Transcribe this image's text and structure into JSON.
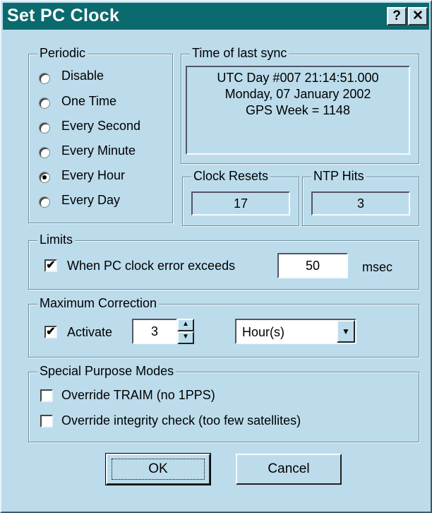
{
  "dialog": {
    "title": "Set PC Clock",
    "help_label": "?",
    "close_label": "✕"
  },
  "periodic": {
    "legend": "Periodic",
    "options": [
      {
        "label": "Disable",
        "selected": false
      },
      {
        "label": "One Time",
        "selected": false
      },
      {
        "label": "Every Second",
        "selected": false
      },
      {
        "label": "Every Minute",
        "selected": false
      },
      {
        "label": "Every Hour",
        "selected": true
      },
      {
        "label": "Every Day",
        "selected": false
      }
    ]
  },
  "last_sync": {
    "legend": "Time of last sync",
    "lines": [
      "UTC Day #007  21:14:51.000",
      "Monday, 07 January 2002",
      "GPS Week = 1148"
    ]
  },
  "clock_resets": {
    "legend": "Clock Resets",
    "value": "17"
  },
  "ntp_hits": {
    "legend": "NTP Hits",
    "value": "3"
  },
  "limits": {
    "legend": "Limits",
    "checkbox_label": "When PC clock error exceeds",
    "checked": true,
    "value": "50",
    "unit": "msec"
  },
  "max_correction": {
    "legend": "Maximum Correction",
    "checkbox_label": "Activate",
    "checked": true,
    "value": "3",
    "unit_selected": "Hour(s)"
  },
  "special": {
    "legend": "Special Purpose Modes",
    "options": [
      {
        "label": "Override TRAIM (no 1PPS)",
        "checked": false
      },
      {
        "label": "Override integrity check (too few satellites)",
        "checked": false
      }
    ]
  },
  "buttons": {
    "ok": "OK",
    "cancel": "Cancel"
  },
  "colors": {
    "titlebar": "#0b6a6e",
    "face": "#bcdcec"
  }
}
